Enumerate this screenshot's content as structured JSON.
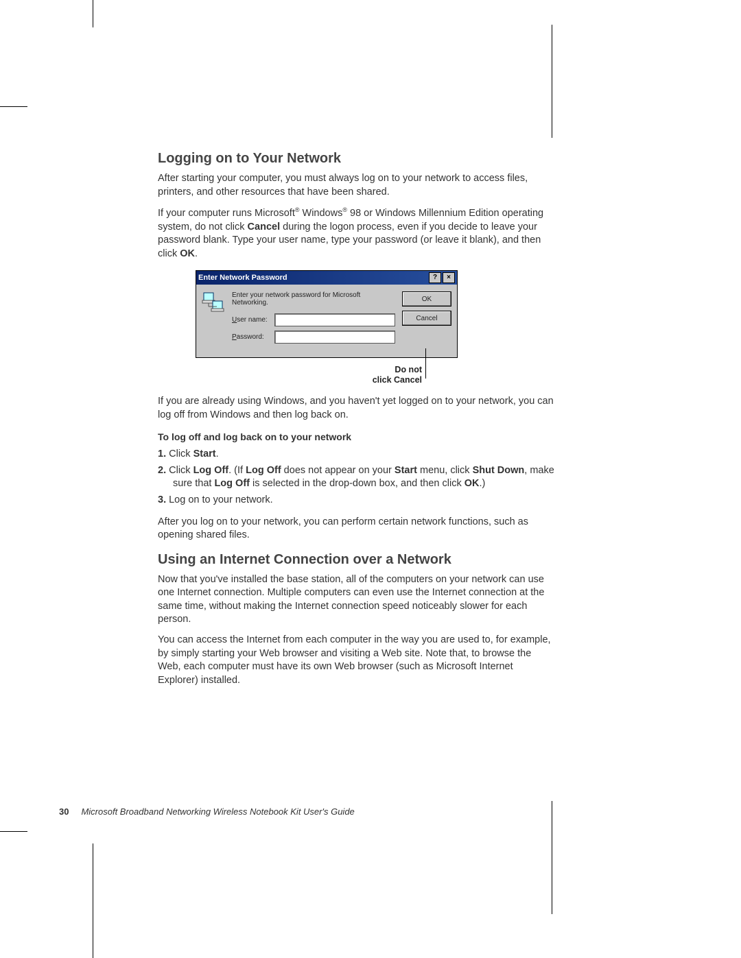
{
  "heading1": "Logging on to Your Network",
  "para1": "After starting your computer, you must always log on to your network to access files, printers, and other resources that have been shared.",
  "para2_pre": "If your computer runs Microsoft",
  "para2_reg1": "®",
  "para2_mid1": " Windows",
  "para2_reg2": "®",
  "para2_mid2": " 98 or Windows Millennium Edition operating system, do not click ",
  "para2_b1": "Cancel",
  "para2_mid3": " during the logon process, even if you decide to leave your password blank. Type your user name, type your password (or leave it blank), and then click ",
  "para2_b2": "OK",
  "para2_end": ".",
  "dialog": {
    "title": "Enter Network Password",
    "help_btn": "?",
    "close_btn": "×",
    "message": "Enter your network password for Microsoft Networking.",
    "username_label_u": "U",
    "username_label_rest": "ser name:",
    "username_value": "",
    "password_label_u": "P",
    "password_label_rest": "assword:",
    "password_value": "",
    "ok_label": "OK",
    "cancel_label": "Cancel"
  },
  "callout_line1": "Do not",
  "callout_line2": "click Cancel",
  "para3": "If you are already using Windows, and you haven't yet logged on to your network, you can log off from Windows and then log back on.",
  "steps_title": "To log off and log back on to your network",
  "step1_num": "1.",
  "step1_a": " Click ",
  "step1_b": "Start",
  "step1_c": ".",
  "step2_num": "2.",
  "step2_a": " Click ",
  "step2_b1": "Log Off",
  "step2_c": ". (If ",
  "step2_b2": "Log Off",
  "step2_d": " does not appear on your ",
  "step2_b3": "Start",
  "step2_e": " menu, click ",
  "step2_b4": "Shut Down",
  "step2_f": ", make sure that ",
  "step2_b5": "Log Off",
  "step2_g": " is selected in the drop-down box, and then click ",
  "step2_b6": "OK",
  "step2_h": ".)",
  "step3_num": "3.",
  "step3_a": "  Log on to your network.",
  "para4": "After you log on to your network, you can perform certain network functions, such as opening shared files.",
  "heading2": "Using an Internet Connection over a Network",
  "para5": "Now that you've installed the base station, all of the computers on your network can use one Internet connection. Multiple computers can even use the Internet connection at the same time, without making the Internet connection speed noticeably slower for each person.",
  "para6": "You can access the Internet from each computer in the way you are used to, for example, by simply starting your Web browser and visiting a Web site. Note that, to browse the Web, each computer must have its own Web browser (such as Microsoft Internet Explorer) installed.",
  "footer_page": "30",
  "footer_title": "Microsoft Broadband Networking Wireless Notebook Kit User's Guide"
}
